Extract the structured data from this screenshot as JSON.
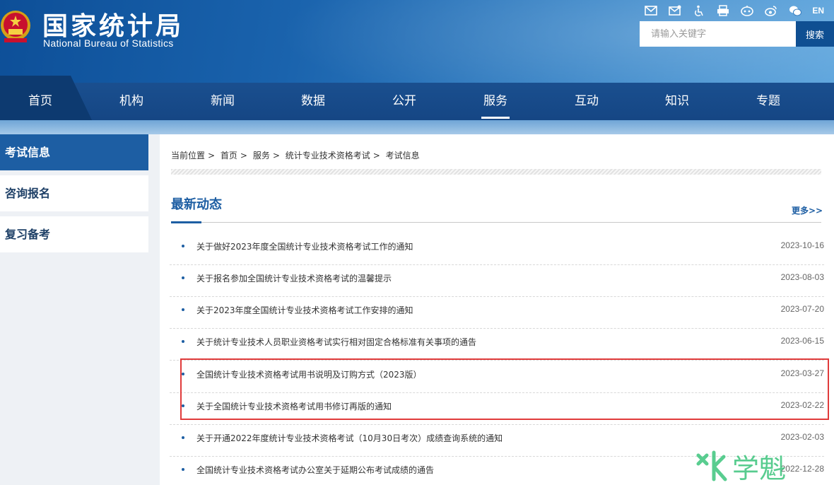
{
  "header": {
    "logo_cn": "国家统计局",
    "logo_en": "National Bureau of Statistics",
    "language": "EN",
    "search_placeholder": "请输入关键字",
    "search_button": "搜索",
    "icons": [
      "mail-icon",
      "mailbox-icon",
      "accessibility-icon",
      "print-icon",
      "robot-icon",
      "weibo-icon",
      "wechat-icon"
    ]
  },
  "nav": {
    "items": [
      "首页",
      "机构",
      "新闻",
      "数据",
      "公开",
      "服务",
      "互动",
      "知识",
      "专题"
    ],
    "active": "服务"
  },
  "sidebar": {
    "items": [
      {
        "label": "考试信息",
        "active": true
      },
      {
        "label": "咨询报名",
        "active": false
      },
      {
        "label": "复习备考",
        "active": false
      }
    ]
  },
  "breadcrumb": {
    "prefix": "当前位置",
    "items": [
      "首页",
      "服务",
      "统计专业技术资格考试",
      "考试信息"
    ],
    "separator": ">"
  },
  "section": {
    "title": "最新动态",
    "more": "更多>>"
  },
  "news": [
    {
      "title": "关于做好2023年度全国统计专业技术资格考试工作的通知",
      "date": "2023-10-16"
    },
    {
      "title": "关于报名参加全国统计专业技术资格考试的温馨提示",
      "date": "2023-08-03"
    },
    {
      "title": "关于2023年度全国统计专业技术资格考试工作安排的通知",
      "date": "2023-07-20"
    },
    {
      "title": "关于统计专业技术人员职业资格考试实行相对固定合格标准有关事项的通告",
      "date": "2023-06-15"
    },
    {
      "title": "全国统计专业技术资格考试用书说明及订购方式（2023版）",
      "date": "2023-03-27"
    },
    {
      "title": "关于全国统计专业技术资格考试用书修订再版的通知",
      "date": "2023-02-22"
    },
    {
      "title": "关于开通2022年度统计专业技术资格考试（10月30日考次）成绩查询系统的通知",
      "date": "2023-02-03"
    },
    {
      "title": "全国统计专业技术资格考试办公室关于延期公布考试成绩的通告",
      "date": "2022-12-28"
    }
  ],
  "watermark": "学魁",
  "colors": {
    "primary": "#1d5ea3",
    "nav": "#154684",
    "highlight": "#e03b3b",
    "watermark": "#3cc47c"
  }
}
